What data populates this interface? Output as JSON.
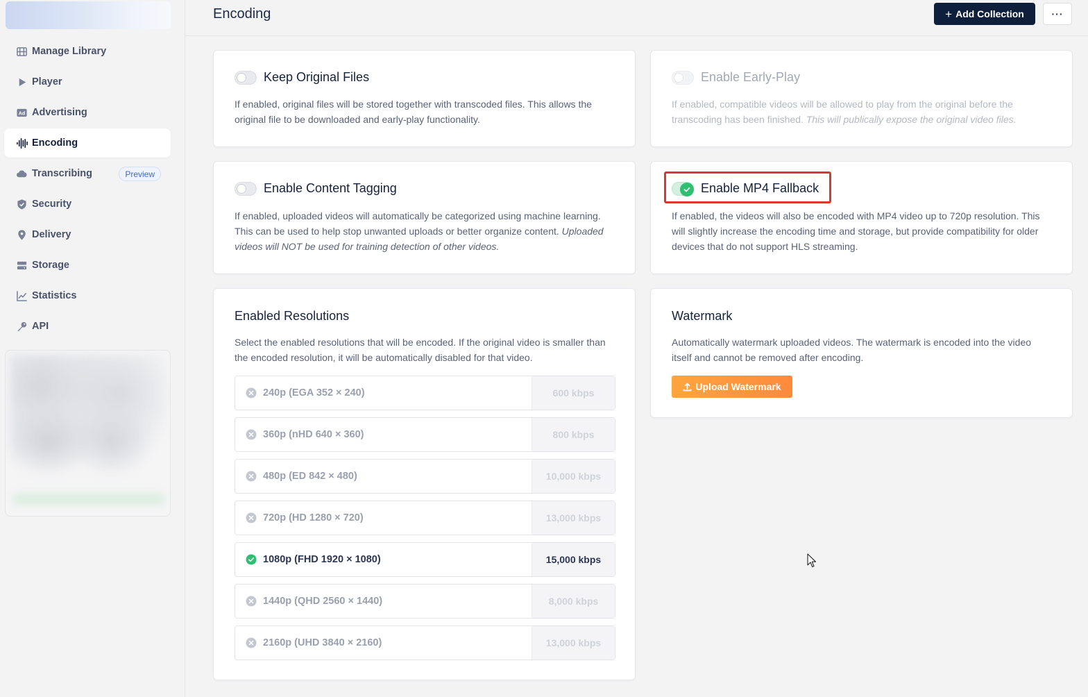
{
  "sidebar": {
    "items": [
      {
        "label": "Manage Library",
        "icon": "film-grid-icon"
      },
      {
        "label": "Player",
        "icon": "play-icon"
      },
      {
        "label": "Advertising",
        "icon": "ad-icon"
      },
      {
        "label": "Encoding",
        "icon": "waveform-icon",
        "active": true
      },
      {
        "label": "Transcribing",
        "icon": "cloud-icon",
        "badge": "Preview"
      },
      {
        "label": "Security",
        "icon": "shield-icon"
      },
      {
        "label": "Delivery",
        "icon": "map-pin-icon"
      },
      {
        "label": "Storage",
        "icon": "storage-icon"
      },
      {
        "label": "Statistics",
        "icon": "chart-line-icon"
      },
      {
        "label": "API",
        "icon": "key-icon"
      }
    ]
  },
  "header": {
    "title": "Encoding",
    "add_collection_label": "Add Collection",
    "more_label": "···"
  },
  "cards": {
    "keep_original": {
      "title": "Keep Original Files",
      "enabled": false,
      "description": "If enabled, original files will be stored together with transcoded files. This allows the original file to be downloaded and early-play functionality."
    },
    "early_play": {
      "title": "Enable Early-Play",
      "enabled": false,
      "disabled": true,
      "description": "If enabled, compatible videos will be allowed to play from the original before the transcoding has been finished.",
      "description_em": "This will publically expose the original video files."
    },
    "content_tagging": {
      "title": "Enable Content Tagging",
      "enabled": false,
      "description": "If enabled, uploaded videos will automatically be categorized using machine learning. This can be used to help stop unwanted uploads or better organize content.",
      "description_em": "Uploaded videos will NOT be used for training detection of other videos."
    },
    "mp4_fallback": {
      "title": "Enable MP4 Fallback",
      "enabled": true,
      "description": "If enabled, the videos will also be encoded with MP4 video up to 720p resolution. This will slightly increase the encoding time and storage, but provide compatibility for older devices that do not support HLS streaming."
    },
    "resolutions": {
      "title": "Enabled Resolutions",
      "description": "Select the enabled resolutions that will be encoded. If the original video is smaller than the encoded resolution, it will be automatically disabled for that video.",
      "items": [
        {
          "label": "240p (EGA 352 × 240)",
          "rate": "600 kbps",
          "enabled": false
        },
        {
          "label": "360p (nHD 640 × 360)",
          "rate": "800 kbps",
          "enabled": false
        },
        {
          "label": "480p (ED 842 × 480)",
          "rate": "10,000 kbps",
          "enabled": false
        },
        {
          "label": "720p (HD 1280 × 720)",
          "rate": "13,000 kbps",
          "enabled": false
        },
        {
          "label": "1080p (FHD 1920 × 1080)",
          "rate": "15,000 kbps",
          "enabled": true
        },
        {
          "label": "1440p (QHD 2560 × 1440)",
          "rate": "8,000 kbps",
          "enabled": false
        },
        {
          "label": "2160p (UHD 3840 × 2160)",
          "rate": "13,000 kbps",
          "enabled": false
        }
      ]
    },
    "watermark": {
      "title": "Watermark",
      "description": "Automatically watermark uploaded videos. The watermark is encoded into the video itself and cannot be removed after encoding.",
      "upload_label": "Upload Watermark"
    }
  },
  "colors": {
    "primary": "#0e1f3b",
    "success": "#2fbf71",
    "accent": "#ff9a3d",
    "highlight": "#d93636"
  }
}
